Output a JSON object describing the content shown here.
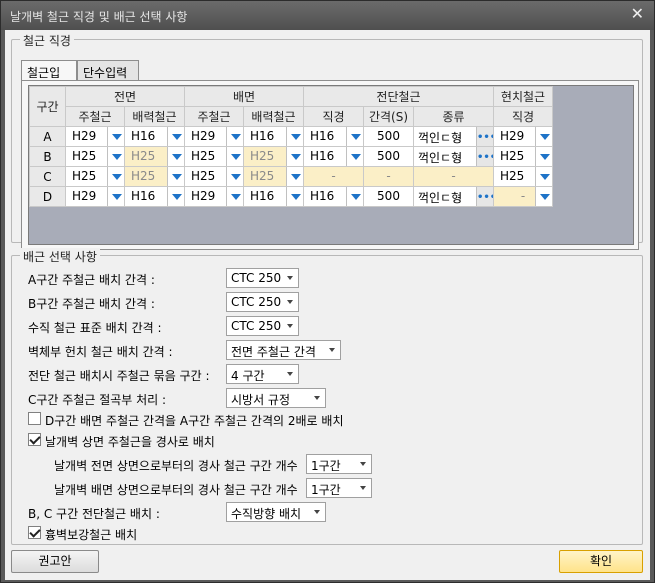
{
  "window": {
    "title": "날개벽 철근 직경 및 배근 선택 사항"
  },
  "rebar_diameter": {
    "group_title": "철근 직경",
    "tabs": [
      "철근입력",
      "단수입력"
    ],
    "header": {
      "section": "구간",
      "front": "전면",
      "back": "배면",
      "shear": "전단철근",
      "field": "현치철근",
      "main": "주철근",
      "dist": "배력철근",
      "dia": "직경",
      "spacing": "간격(S)",
      "type": "종류"
    },
    "rows": [
      {
        "section": "A",
        "front_main": "H29",
        "front_dist": "H16",
        "back_main": "H29",
        "back_dist": "H16",
        "shear_dia": "H16",
        "shear_spacing": "500",
        "shear_type": "꺽인ㄷ형",
        "field_dia": "H29"
      },
      {
        "section": "B",
        "front_main": "H25",
        "front_dist": "H25",
        "back_main": "H25",
        "back_dist": "H25",
        "shear_dia": "H16",
        "shear_spacing": "500",
        "shear_type": "꺽인ㄷ형",
        "field_dia": "H25"
      },
      {
        "section": "C",
        "front_main": "H25",
        "front_dist": "H25",
        "back_main": "H25",
        "back_dist": "H25",
        "shear_dia": "-",
        "shear_spacing": "-",
        "shear_type": "-",
        "field_dia": "H25"
      },
      {
        "section": "D",
        "front_main": "H29",
        "front_dist": "H16",
        "back_main": "H29",
        "back_dist": "H16",
        "shear_dia": "H16",
        "shear_spacing": "500",
        "shear_type": "꺽인ㄷ형",
        "field_dia": "-"
      }
    ]
  },
  "options": {
    "group_title": "배근 선택 사항",
    "a_main_spacing": {
      "label": "A구간 주철근 배치 간격 :",
      "value": "CTC 250"
    },
    "b_main_spacing": {
      "label": "B구간 주철근 배치 간격 :",
      "value": "CTC 250"
    },
    "vertical_spacing": {
      "label": "수직 철근 표준 배치 간격 :",
      "value": "CTC 250"
    },
    "haunch_spacing": {
      "label": "벽체부 헌치 철근 배치 간격 :",
      "value": "전면 주철근 간격"
    },
    "shear_bundle": {
      "label": "전단 철근 배치시 주철근 묶음 구간 :",
      "value": "4 구간"
    },
    "c_cutoff": {
      "label": "C구간 주철근 절곡부 처리 :",
      "value": "시방서 규정"
    },
    "d_double": {
      "label": "D구간 배면 주철근 간격을 A구간 주철근 간격의 2배로 배치",
      "checked": false
    },
    "slope_top": {
      "label": "날개벽 상면 주철근을 경사로 배치",
      "checked": true
    },
    "slope_front": {
      "label": "날개벽 전면 상면으로부터의 경사 철근 구간 개수",
      "value": "1구간"
    },
    "slope_back": {
      "label": "날개벽 배면 상면으로부터의 경사 철근 구간 개수",
      "value": "1구간"
    },
    "bc_shear": {
      "label": "B, C 구간 전단철근 배치 :",
      "value": "수직방향 배치"
    },
    "wall_reinf": {
      "label": "흉벽보강철근 배치",
      "checked": true
    }
  },
  "buttons": {
    "recommend": "권고안",
    "ok": "확인"
  },
  "colors": {
    "title_bar": "#5a5a5a",
    "dropdown_arrow": "#1e73c8",
    "disabled_cell": "#fbefc7",
    "ok_button": "#ffe38a"
  }
}
